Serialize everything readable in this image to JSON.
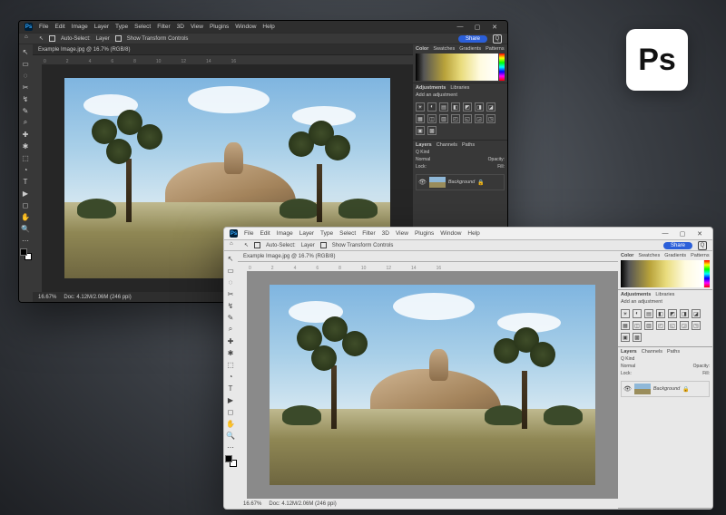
{
  "badge": {
    "text": "Ps"
  },
  "menu": [
    "File",
    "Edit",
    "Image",
    "Layer",
    "Type",
    "Select",
    "Filter",
    "3D",
    "View",
    "Plugins",
    "Window",
    "Help"
  ],
  "options": {
    "auto_select": "Auto-Select:",
    "layer": "Layer",
    "show_tc": "Show Transform Controls",
    "share": "Share"
  },
  "doc": {
    "title": "Example Image.jpg @ 16.7% (RGB/8)"
  },
  "ruler_marks": [
    "0",
    "2",
    "4",
    "6",
    "8",
    "10",
    "12",
    "14",
    "16"
  ],
  "tools": [
    "↖",
    "▭",
    "◌",
    "✂",
    "↯",
    "✎",
    "⌕",
    "✚",
    "✱",
    "⬚",
    "◔",
    "T",
    "▶",
    "◻",
    "✋",
    "🔍",
    "⋯"
  ],
  "panels": {
    "color": {
      "tabs": [
        "Color",
        "Swatches",
        "Gradients",
        "Patterns"
      ]
    },
    "adjust": {
      "tabs": [
        "Adjustments",
        "Libraries"
      ],
      "hint": "Add an adjustment",
      "icons": [
        "☀",
        "◐",
        "▤",
        "◧",
        "◩",
        "◨",
        "◪",
        "▦",
        "◫",
        "▥",
        "◰",
        "◱",
        "◲",
        "◳",
        "▣",
        "▩"
      ]
    },
    "layers": {
      "tabs": [
        "Layers",
        "Channels",
        "Paths"
      ],
      "kind": "Q Kind",
      "mode": "Normal",
      "opacity": "Opacity:",
      "lock": "Lock:",
      "fill": "Fill:",
      "bg_layer": "Background"
    }
  },
  "status": {
    "zoom": "16.67%",
    "dims": "Doc: 4.12M/2.06M (246 ppi)"
  }
}
